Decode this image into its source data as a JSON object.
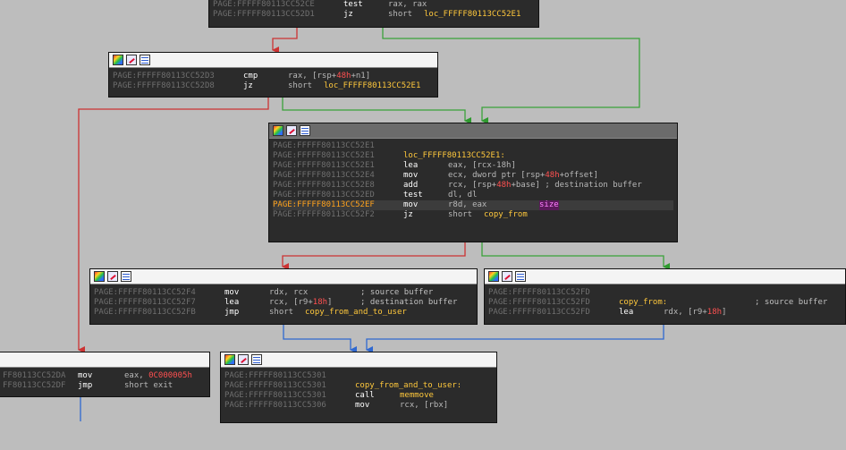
{
  "colors": {
    "background": "#bdbdbd",
    "node_bg": "#2b2b2b",
    "address": "#6f6f6f",
    "address_highlight": "#ffa21c",
    "label": "#ffc83c",
    "immediate": "#ff5050",
    "edge_false": "#cc3333",
    "edge_true": "#3aa23a",
    "edge_jump": "#2f68d0"
  },
  "header_icons": [
    "graph-icon",
    "edit-icon",
    "xref-icon"
  ],
  "blocks": {
    "top": {
      "rows": [
        {
          "addr": "PAGE:FFFFF80113CC52CE",
          "mnem": "test",
          "ops": "rax, rax"
        },
        {
          "addr": "PAGE:FFFFF80113CC52D1",
          "mnem": "jz",
          "ops": "short",
          "label": "loc_FFFFF80113CC52E1"
        }
      ]
    },
    "cmp": {
      "rows": [
        {
          "addr": "PAGE:FFFFF80113CC52D3",
          "mnem": "cmp",
          "ops_a": "rax, [rsp+",
          "imm": "48h",
          "ops_b": "+n1]"
        },
        {
          "addr": "PAGE:FFFFF80113CC52D8",
          "mnem": "jz",
          "ops": "short",
          "label": "loc_FFFFF80113CC52E1"
        }
      ]
    },
    "center": {
      "rows": [
        {
          "addr": "PAGE:FFFFF80113CC52E1"
        },
        {
          "addr": "PAGE:FFFFF80113CC52E1",
          "label": "loc_FFFFF80113CC52E1:"
        },
        {
          "addr": "PAGE:FFFFF80113CC52E1",
          "mnem": "lea",
          "ops": "eax, [rcx-18h]"
        },
        {
          "addr": "PAGE:FFFFF80113CC52E4",
          "mnem": "mov",
          "ops_a": "ecx, dword ptr [rsp+",
          "imm": "48h",
          "ops_b": "+offset]"
        },
        {
          "addr": "PAGE:FFFFF80113CC52E8",
          "mnem": "add",
          "ops_a": "rcx, [rsp+",
          "imm": "48h",
          "ops_b": "+base] ; destination buffer"
        },
        {
          "addr": "PAGE:FFFFF80113CC52ED",
          "mnem": "test",
          "ops": "dl, dl"
        },
        {
          "addr": "PAGE:FFFFF80113CC52EF",
          "mnem": "mov",
          "ops": "r8d, eax",
          "comment_pre": "; ",
          "comment_sel": "size"
        },
        {
          "addr": "PAGE:FFFFF80113CC52F2",
          "mnem": "jz",
          "ops": "short",
          "label": "copy_from"
        }
      ]
    },
    "left": {
      "rows": [
        {
          "addr": "PAGE:FFFFF80113CC52F4",
          "mnem": "mov",
          "ops": "rdx, rcx",
          "comment": "; source buffer"
        },
        {
          "addr": "PAGE:FFFFF80113CC52F7",
          "mnem": "lea",
          "ops_a": "rcx, [r9+",
          "imm": "18h",
          "ops_b": "]",
          "comment": "; destination buffer"
        },
        {
          "addr": "PAGE:FFFFF80113CC52FB",
          "mnem": "jmp",
          "ops": "short",
          "label": "copy_from_and_to_user"
        }
      ]
    },
    "right": {
      "rows": [
        {
          "addr": "PAGE:FFFFF80113CC52FD"
        },
        {
          "addr": "PAGE:FFFFF80113CC52FD",
          "label": "copy_from:",
          "comment": "; source buffer"
        },
        {
          "addr": "PAGE:FFFFF80113CC52FD",
          "mnem": "lea",
          "ops_a": "rdx, [r9+",
          "imm": "18h",
          "ops_b": "]"
        }
      ]
    },
    "farleft": {
      "rows": [
        {
          "addr": "FF80113CC52DA",
          "mnem": "mov",
          "ops_a": "eax, ",
          "imm": "0C000005h"
        },
        {
          "addr": "FF80113CC52DF",
          "mnem": "jmp",
          "ops": "short exit"
        }
      ]
    },
    "bottom": {
      "rows": [
        {
          "addr": "PAGE:FFFFF80113CC5301"
        },
        {
          "addr": "PAGE:FFFFF80113CC5301",
          "label": "copy_from_and_to_user:"
        },
        {
          "addr": "PAGE:FFFFF80113CC5301",
          "mnem": "call",
          "label": "memmove"
        },
        {
          "addr": "PAGE:FFFFF80113CC5306",
          "mnem": "mov",
          "ops": "rcx, [rbx]"
        }
      ]
    }
  }
}
